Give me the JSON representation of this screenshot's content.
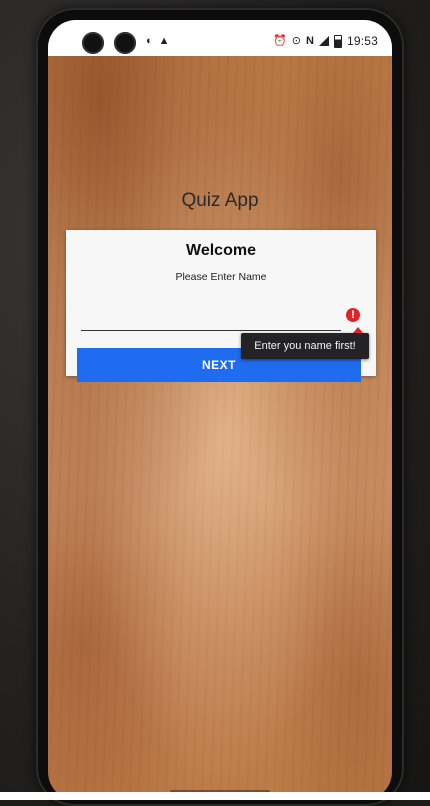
{
  "status_bar": {
    "left_icons": [
      "image-icon",
      "warning-icon"
    ],
    "right_icons": [
      "alarm-icon",
      "location-icon",
      "nfc-icon",
      "signal-icon",
      "battery-icon"
    ],
    "time": "19:53"
  },
  "app": {
    "title": "Quiz App"
  },
  "card": {
    "title": "Welcome",
    "subtitle": "Please Enter Name",
    "name_input": {
      "value": "",
      "placeholder": ""
    },
    "error_message": "Enter you name first!",
    "next_label": "NEXT"
  },
  "colors": {
    "button": "#1f6cf0",
    "error": "#e0222b",
    "tooltip": "#232326",
    "card": "#f7f7f8"
  }
}
